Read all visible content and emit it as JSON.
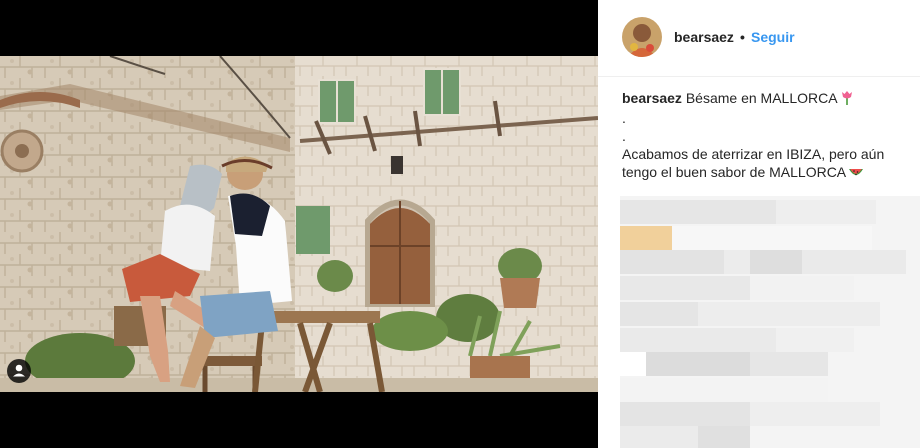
{
  "post": {
    "username": "bearsaez",
    "separator": "•",
    "follow_label": "Seguir",
    "caption_username": "bearsaez",
    "caption_first": "Bésame en MALLORCA",
    "caption_dot_1": ".",
    "caption_dot_2": ".",
    "caption_line_3": "Acabamos de aterrizar en IBIZA, pero aún",
    "caption_line_4": "tengo el buen sabor de MALLORCA"
  },
  "icons": {
    "first_emoji": "tulip-icon",
    "second_emoji": "watermelon-icon",
    "tag_button": "user-tag-icon"
  },
  "colors": {
    "follow": "#3897f0",
    "text": "#262626",
    "media_bg": "#000000"
  }
}
